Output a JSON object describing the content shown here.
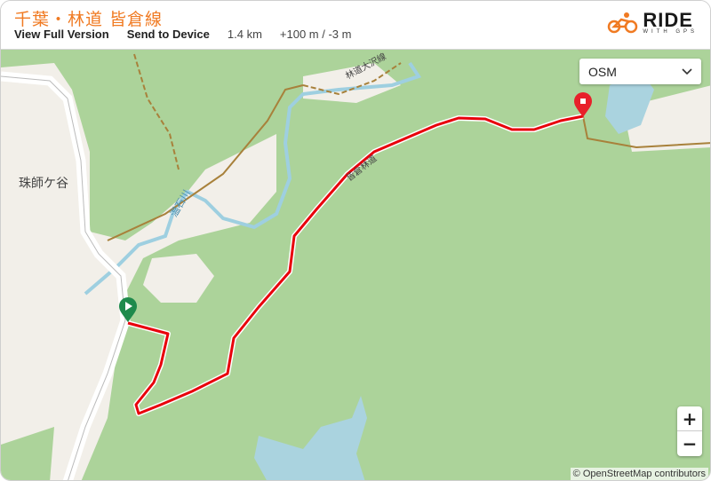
{
  "header": {
    "title": "千葉・林道 皆倉線",
    "view_full_version": "View Full Version",
    "send_to_device": "Send to Device",
    "distance": "1.4 km",
    "elevation": "+100 m / -3 m",
    "logo": {
      "main": "RIDE",
      "sub": "WITH GPS",
      "accent_color": "#f07a22"
    }
  },
  "map": {
    "layer_select": {
      "selected": "OSM"
    },
    "zoom_in": "+",
    "zoom_out": "−",
    "attribution": "© OpenStreetMap contributors",
    "labels": {
      "place": "珠師ケ谷",
      "road_osawa": "林道大沢線",
      "road_minakura": "皆倉林道",
      "river": "温石川"
    },
    "route_color": "#e8000b",
    "start_marker_color": "#1f8a4c",
    "end_marker_color": "#e8202a"
  }
}
